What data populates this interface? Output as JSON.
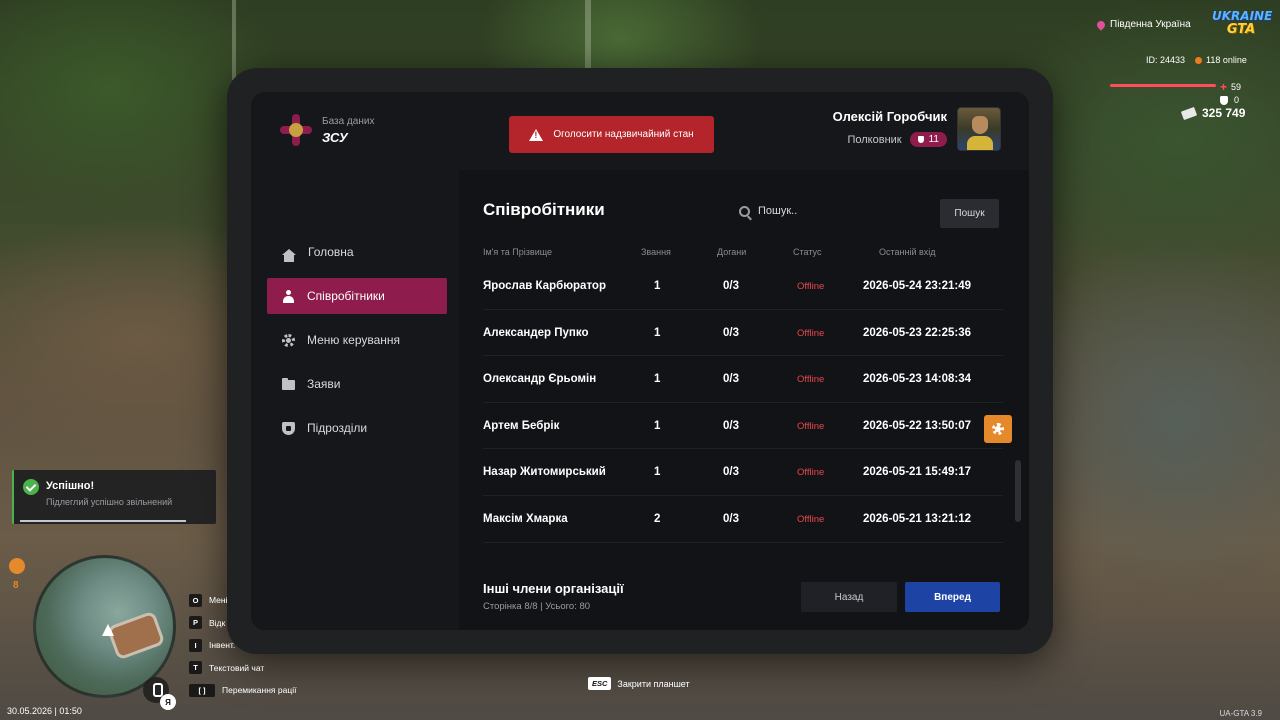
{
  "hud": {
    "region": "Південна Україна",
    "logo_top": "UKRAINE",
    "logo_bottom": "GTA",
    "player_id": "ID: 24433",
    "online": "118 online",
    "health": "59",
    "armor": "0",
    "money": "325 749"
  },
  "tablet": {
    "brand_sub": "База даних",
    "brand_title": "ЗСУ",
    "emergency_label": "Оголосити надзвичайний стан",
    "user_name": "Олексій Горобчик",
    "user_rank": "Полковник",
    "user_rank_level": "11"
  },
  "nav": {
    "items": [
      {
        "label": "Головна",
        "icon": "home-icon"
      },
      {
        "label": "Співробітники",
        "icon": "users-icon",
        "active": true
      },
      {
        "label": "Меню керування",
        "icon": "gear-icon"
      },
      {
        "label": "Заяви",
        "icon": "folder-icon"
      },
      {
        "label": "Підрозділи",
        "icon": "shield-icon"
      }
    ]
  },
  "content": {
    "title": "Співробітники",
    "search_placeholder": "Пошук..",
    "search_button": "Пошук",
    "columns": [
      "Ім'я та Прізвище",
      "Звання",
      "Догани",
      "Статус",
      "Останній вхід"
    ],
    "rows": [
      {
        "name": "Ярослав Карбюратор",
        "rank": "1",
        "warns": "0/3",
        "status": "Offline",
        "last": "2026-05-24 23:21:49"
      },
      {
        "name": "Александер Пупко",
        "rank": "1",
        "warns": "0/3",
        "status": "Offline",
        "last": "2026-05-23 22:25:36"
      },
      {
        "name": "Олександр Єрьомін",
        "rank": "1",
        "warns": "0/3",
        "status": "Offline",
        "last": "2026-05-23 14:08:34"
      },
      {
        "name": "Артем Бебрік",
        "rank": "1",
        "warns": "0/3",
        "status": "Offline",
        "last": "2026-05-22 13:50:07"
      },
      {
        "name": "Назар Житомирський",
        "rank": "1",
        "warns": "0/3",
        "status": "Offline",
        "last": "2026-05-21 15:49:17"
      },
      {
        "name": "Максім Хмарка",
        "rank": "2",
        "warns": "0/3",
        "status": "Offline",
        "last": "2026-05-21 13:21:12"
      }
    ],
    "footer_title": "Інші члени організації",
    "footer_sub": "Сторінка 8/8 | Усього: 80",
    "back_button": "Назад",
    "next_button": "Вперед"
  },
  "notification": {
    "title": "Успішно!",
    "message": "Підлеглий успішно звільнений"
  },
  "keybinds": [
    {
      "key": "O",
      "label": "Мені"
    },
    {
      "key": "P",
      "label": "Відк"
    },
    {
      "key": "I",
      "label": "Інвент."
    },
    {
      "key": "T",
      "label": "Текстовий чат"
    },
    {
      "key": "[ ]",
      "label": "Перемикання рації"
    }
  ],
  "bottom": {
    "level": "8",
    "language": "Я",
    "datetime": "30.05.2026 | 01:50",
    "esc_key": "ESC",
    "esc_label": "Закрити планшет",
    "version": "UA-GTA 3.9"
  },
  "colors": {
    "accent": "#8e1d4d",
    "emergency": "#b3252a",
    "primary_button": "#1d43a4",
    "offline": "#e5484d",
    "action": "#e5892a"
  }
}
